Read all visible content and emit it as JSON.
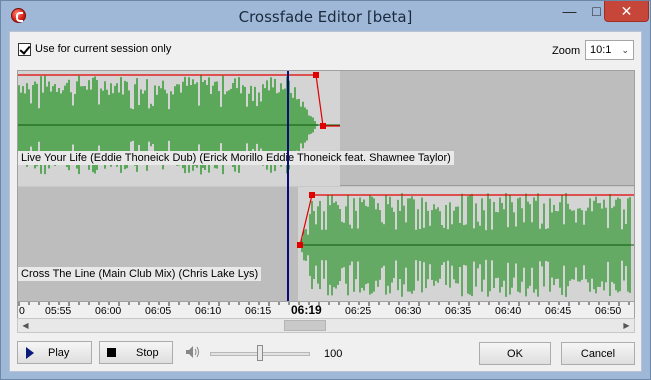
{
  "window": {
    "title": "Crossfade Editor [beta]"
  },
  "options": {
    "session_only_label": "Use for current session only",
    "session_only_checked": true
  },
  "zoom": {
    "label": "Zoom",
    "value": "10:1"
  },
  "tracks": [
    {
      "label": "Live Your Life (Eddie Thoneick Dub) (Erick Morillo  Eddie Thoneick feat. Shawnee Taylor)"
    },
    {
      "label": "Cross The Line (Main Club Mix) (Chris Lake  Lys)"
    }
  ],
  "ruler": {
    "ticks": [
      "0",
      "05:55",
      "06:00",
      "06:05",
      "06:10",
      "06:15",
      "06:25",
      "06:30",
      "06:35",
      "06:40",
      "06:45",
      "06:50"
    ],
    "current": "06:19"
  },
  "transport": {
    "play_label": "Play",
    "stop_label": "Stop",
    "volume": "100"
  },
  "dialog": {
    "ok_label": "OK",
    "cancel_label": "Cancel"
  },
  "colors": {
    "waveform": "#1a8f1a",
    "envelope": "#e00000",
    "playhead": "#0a0a7a"
  }
}
